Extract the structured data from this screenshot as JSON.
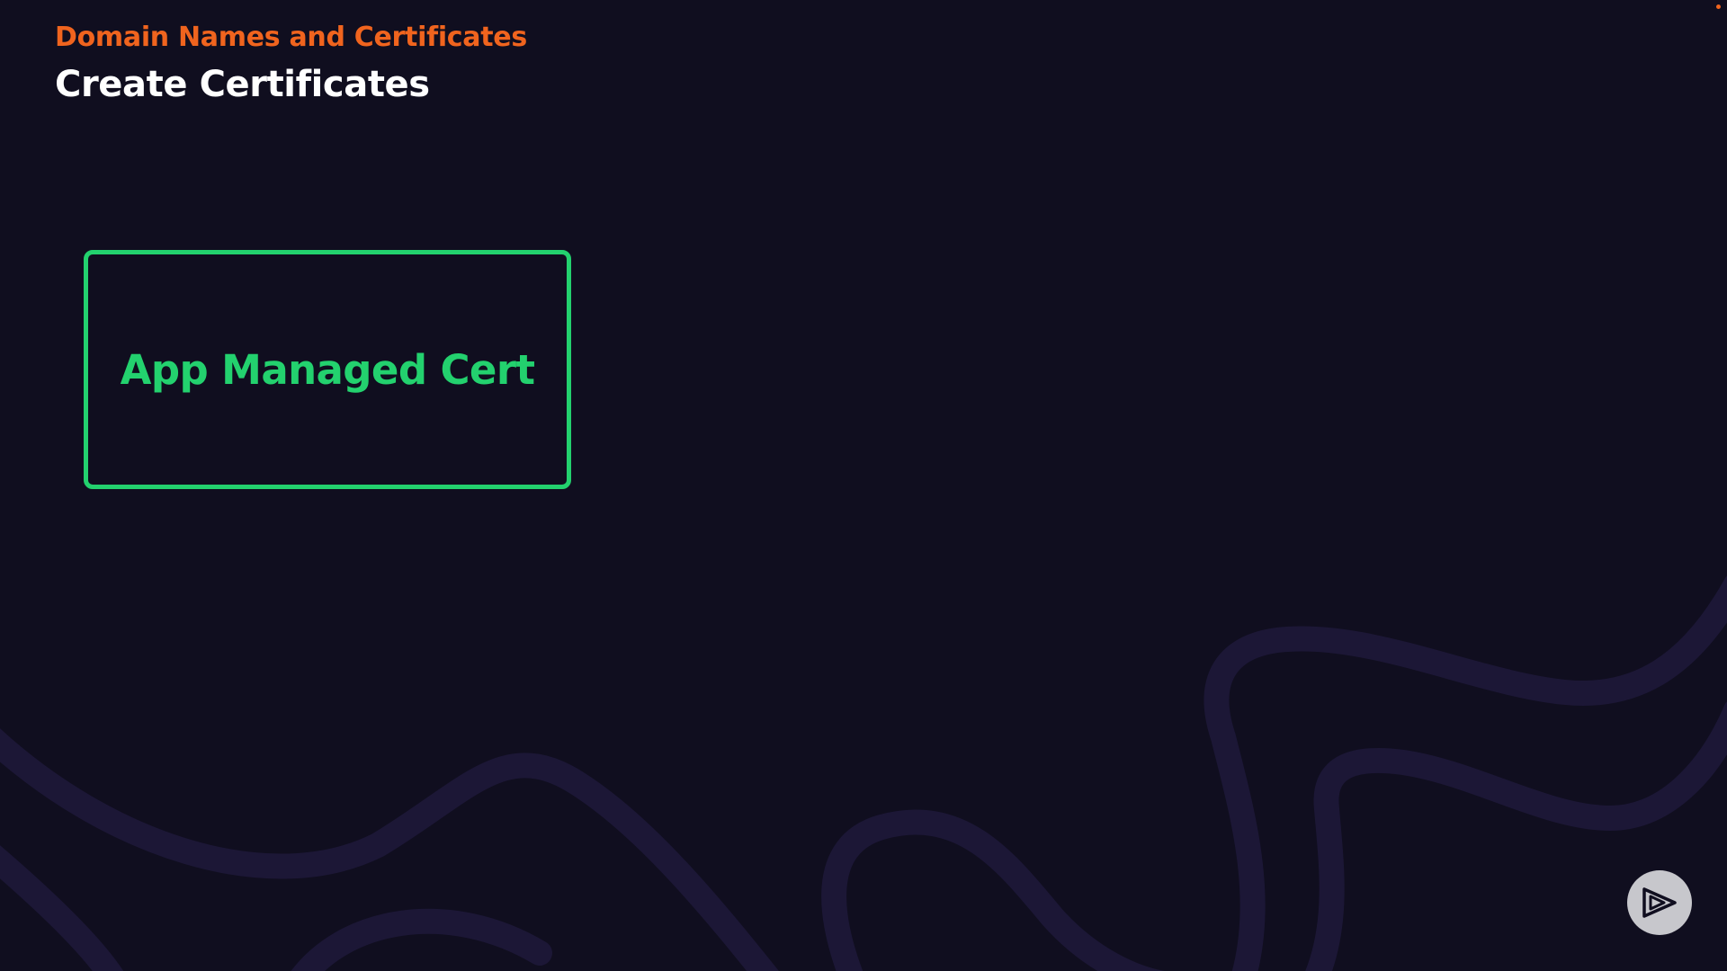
{
  "header": {
    "section_title": "Domain Names and Certificates",
    "page_title": "Create Certificates"
  },
  "card": {
    "label": "App Managed Cert"
  },
  "icons": {
    "brand": "play-logo-icon"
  },
  "colors": {
    "background": "#100e1f",
    "accent_orange": "#f0641e",
    "title_white": "#ffffff",
    "card_green": "#23d16e",
    "wave_purple": "#1c1736",
    "logo_bg": "#c7c7cc",
    "logo_fg": "#100e1f"
  }
}
